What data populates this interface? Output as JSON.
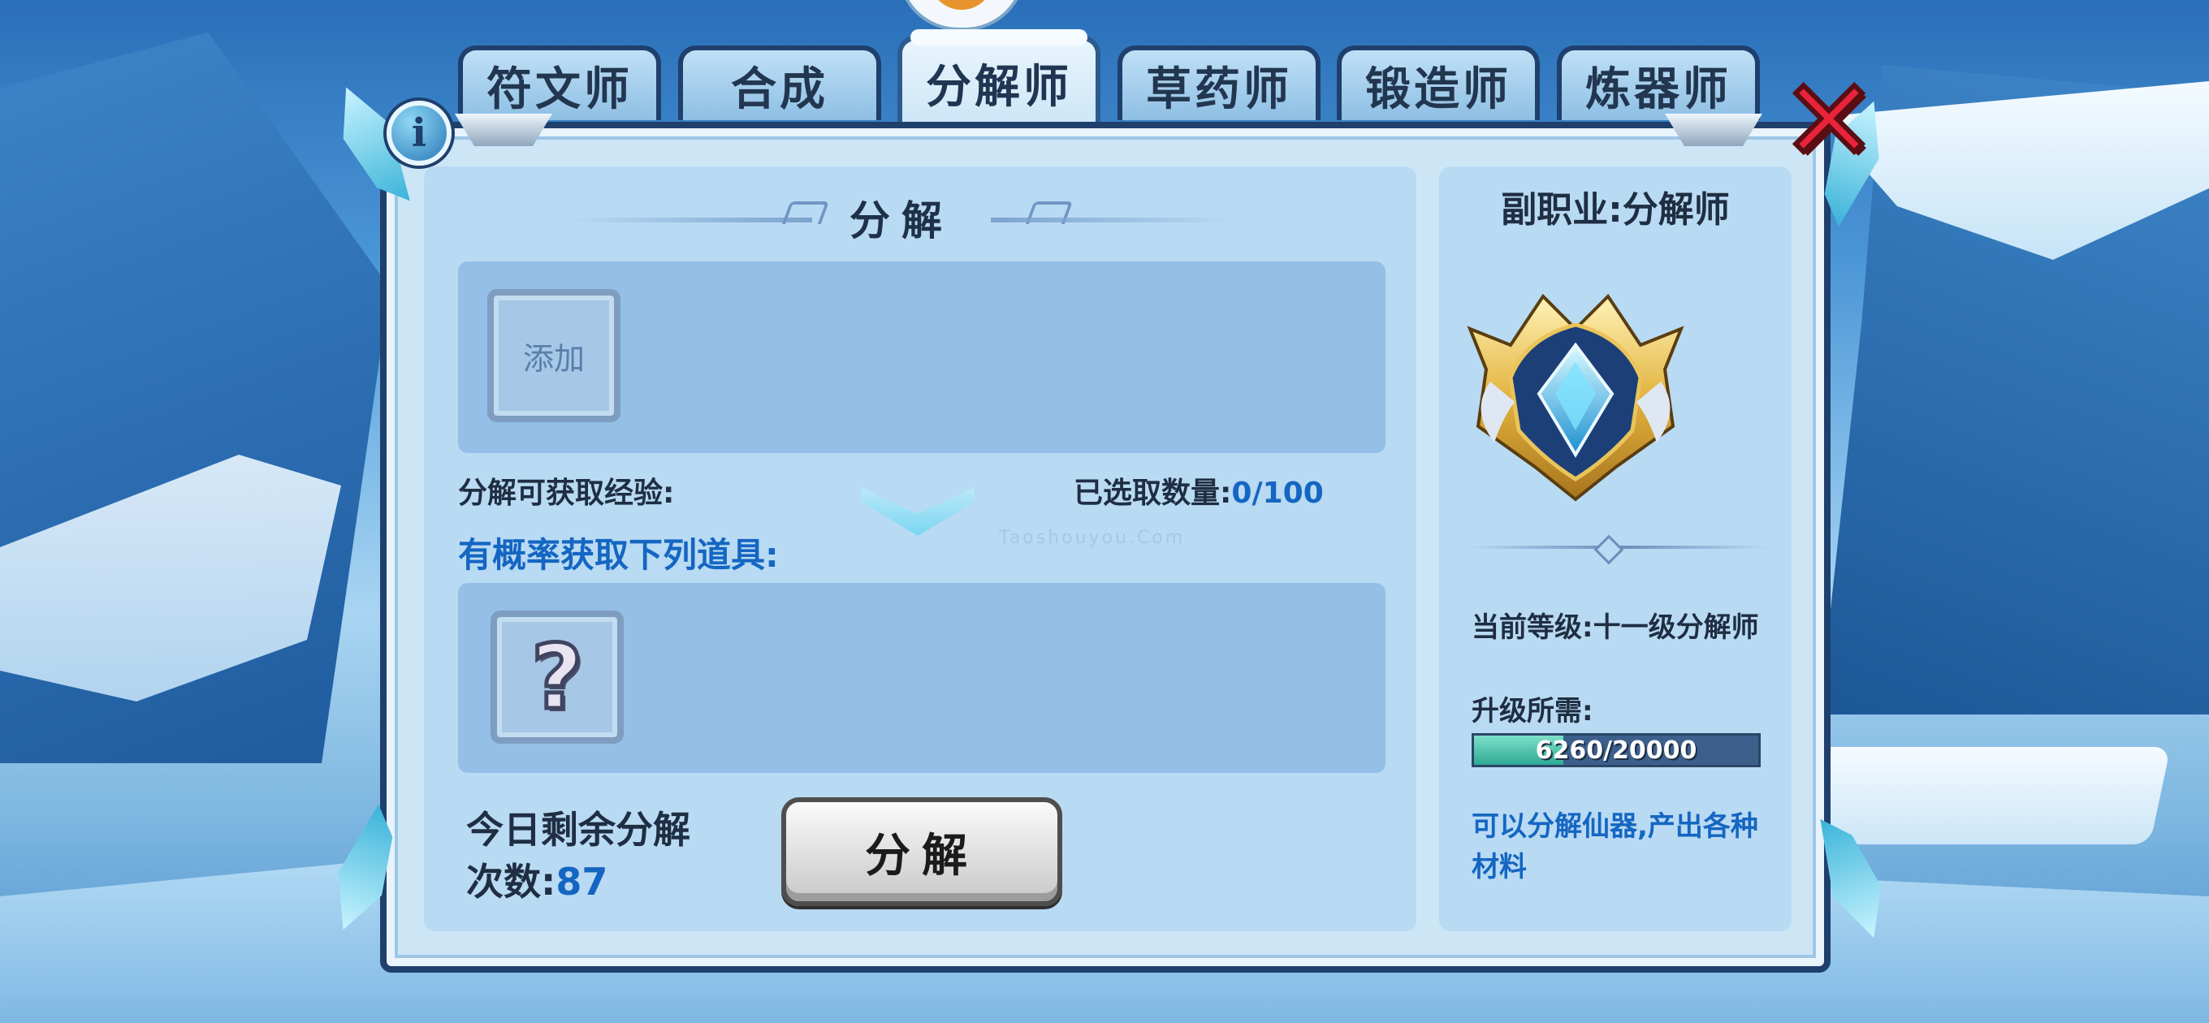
{
  "tabs": [
    {
      "label": "符文师"
    },
    {
      "label": "合成"
    },
    {
      "label": "分解师"
    },
    {
      "label": "草药师"
    },
    {
      "label": "锻造师"
    },
    {
      "label": "炼器师"
    }
  ],
  "active_tab": "分解师",
  "info_icon": "i",
  "main": {
    "section_title": "分解",
    "add_slot_label": "添加",
    "exp_label": "分解可获取经验:",
    "selected_label": "已选取数量:",
    "selected_value": "0/100",
    "drops_heading": "有概率获取下列道具:",
    "unknown_item_glyph": "?",
    "remaining_label_line1": "今日剩余分解",
    "remaining_label_line2": "次数:",
    "remaining_value": "87",
    "decompose_button": "分解"
  },
  "side": {
    "title": "副职业:分解师",
    "badge_icon": "profession-badge-icon",
    "level_label": "当前等级:十一级分解师",
    "upgrade_label": "升级所需:",
    "progress": {
      "current": 6260,
      "max": 20000,
      "text": "6260/20000"
    },
    "description": "可以分解仙器,产出各种材料"
  },
  "watermark": "Taoshouyou.Com",
  "colors": {
    "accent_blue": "#1466c2",
    "close_red": "#e8233a",
    "progress_green": "#2faa95"
  }
}
